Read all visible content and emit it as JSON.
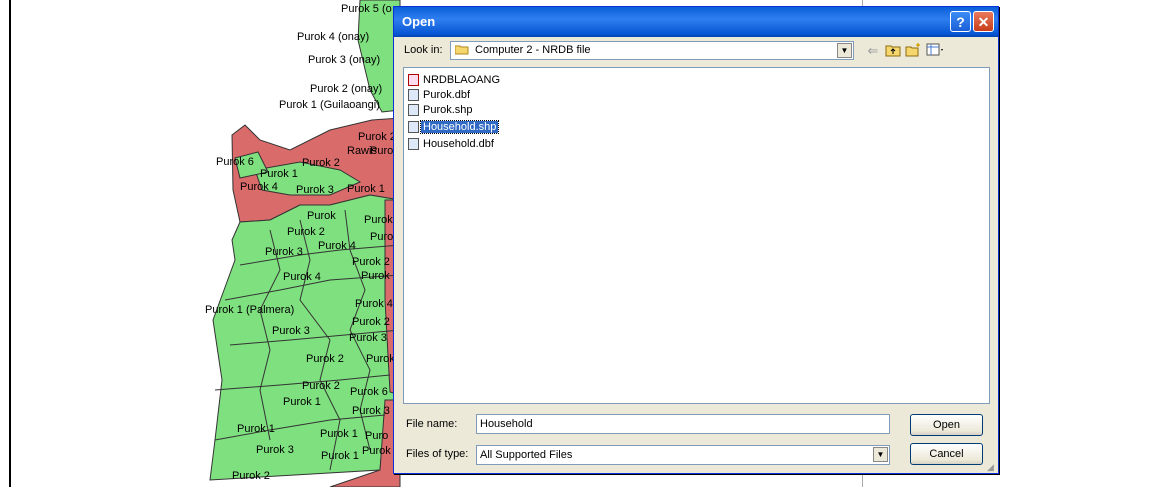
{
  "map": {
    "labels": [
      "Purok 5 (o",
      "Purok 4 (onay)",
      "Purok 3 (onay)",
      "Purok 2 (onay)",
      "Purok 1 (Guilaoangi)",
      "Purok 2",
      "Rawis",
      "Purok",
      "Purok 6",
      "Purok 2",
      "Purok 1",
      "Purok 4",
      "Purok 3",
      "Purok 1",
      "Purok",
      "Purok",
      "Purok 2",
      "Purok 4",
      "Puro",
      "Purok 3",
      "Purok 2",
      "Purok 4",
      "Purok",
      "Purok 1 (Palmera)",
      "Purok 4",
      "Purok 3",
      "Purok 2",
      "Purok 3",
      "Purok 2",
      "Purok",
      "Purok 2",
      "Purok 6",
      "Purok 1",
      "Purok 3",
      "Purok 1",
      "Purok 1",
      "Puro",
      "Purok 3",
      "Purok 1",
      "Purok",
      "Purok 2"
    ],
    "colors": {
      "green": "#7fe07f",
      "red": "#d96b6b",
      "outline": "#333333"
    }
  },
  "dialog": {
    "title": "Open",
    "help_icon": "?",
    "close_icon": "✕",
    "look_in_label": "Look in:",
    "look_in_value": "Computer 2 - NRDB file",
    "toolbar_icons": [
      "back-arrow-icon",
      "up-folder-icon",
      "new-folder-icon",
      "view-menu-icon"
    ],
    "files": [
      {
        "name": "NRDBLAOANG",
        "icon": "nrdb-file-icon",
        "selected": false
      },
      {
        "name": "Purok.dbf",
        "icon": "dbf-file-icon",
        "selected": false
      },
      {
        "name": "Purok.shp",
        "icon": "shp-file-icon",
        "selected": false
      },
      {
        "name": "Household.shp",
        "icon": "shp-file-icon",
        "selected": true
      },
      {
        "name": "Household.dbf",
        "icon": "dbf-file-icon",
        "selected": false
      }
    ],
    "file_name_label": "File name:",
    "file_name_value": "Household",
    "files_of_type_label": "Files of type:",
    "files_of_type_value": "All Supported Files",
    "open_button": "Open",
    "cancel_button": "Cancel",
    "title_color": "#0a5fd8",
    "selection_color": "#316ac5"
  }
}
